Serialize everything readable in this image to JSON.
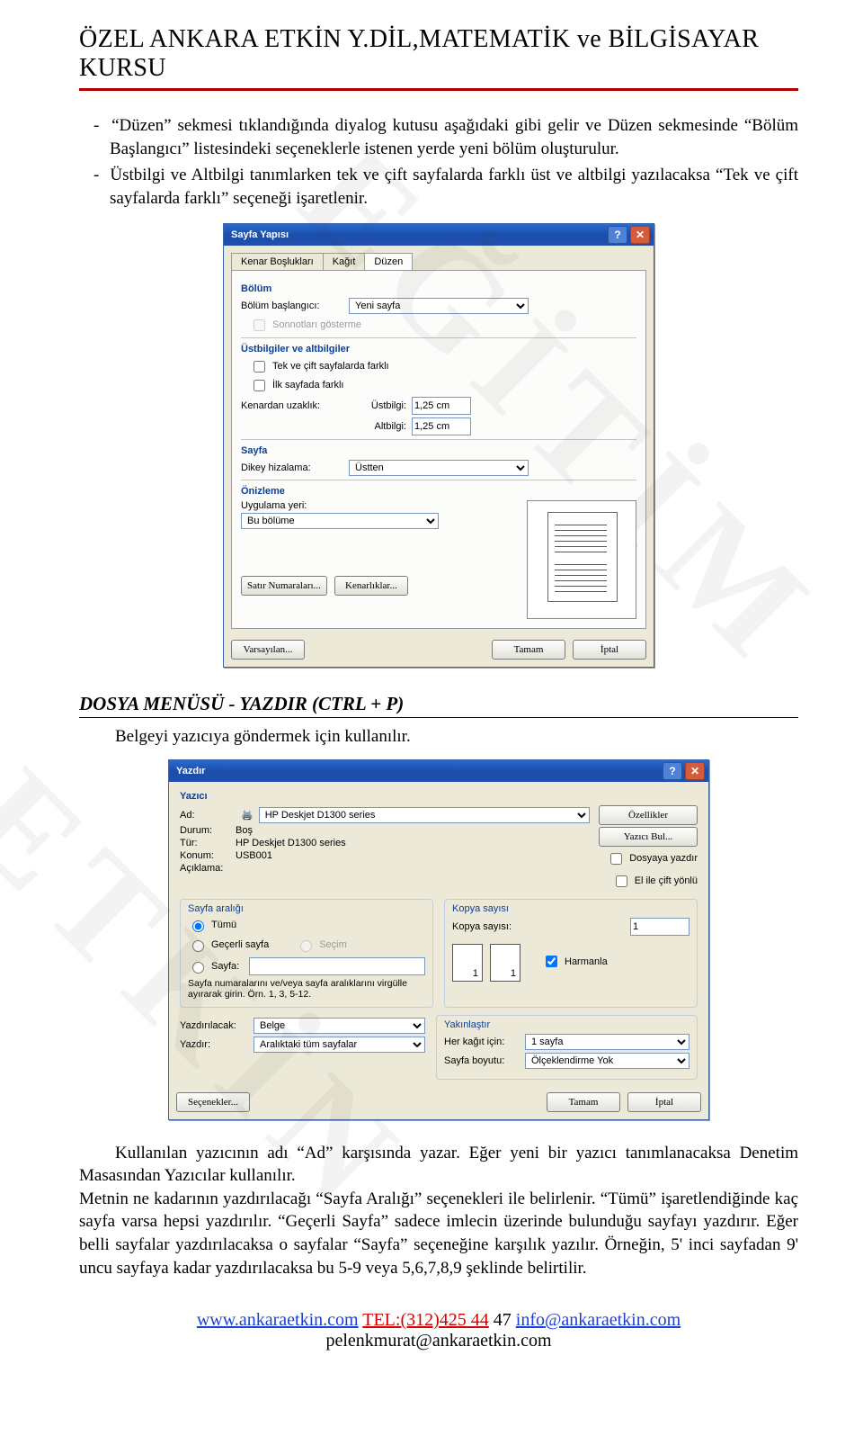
{
  "header": {
    "title": "ÖZEL ANKARA ETKİN Y.DİL,MATEMATİK ve BİLGİSAYAR KURSU"
  },
  "intro": {
    "bullet1": "“Düzen” sekmesi tıklandığında diyalog kutusu aşağıdaki gibi gelir ve Düzen sekmesinde “Bölüm Başlangıcı” listesindeki seçeneklerle istenen yerde yeni bölüm oluşturulur.",
    "bullet2": "Üstbilgi ve Altbilgi tanımlarken tek ve çift sayfalarda farklı üst ve altbilgi yazılacaksa “Tek ve çift sayfalarda farklı” seçeneği işaretlenir."
  },
  "dlg_sayfa": {
    "title": "Sayfa Yapısı",
    "tabs": {
      "t1": "Kenar Boşlukları",
      "t2": "Kağıt",
      "t3": "Düzen"
    },
    "bolum_title": "Bölüm",
    "bolum_baslangici_lbl": "Bölüm başlangıcı:",
    "bolum_baslangici_val": "Yeni sayfa",
    "sonnotlari": "Sonnotları gösterme",
    "ust_title": "Üstbilgiler ve altbilgiler",
    "tek_cift": "Tek ve çift sayfalarda farklı",
    "ilk_sayfa": "İlk sayfada farklı",
    "kenardan_lbl": "Kenardan uzaklık:",
    "ustbilgi_lbl": "Üstbilgi:",
    "altbilgi_lbl": "Altbilgi:",
    "ustbilgi_val": "1,25 cm",
    "altbilgi_val": "1,25 cm",
    "sayfa_title": "Sayfa",
    "dikey_lbl": "Dikey hizalama:",
    "dikey_val": "Üstten",
    "onizleme": "Önizleme",
    "uygulama_lbl": "Uygulama yeri:",
    "uygulama_val": "Bu bölüme",
    "btn_satir": "Satır Numaraları...",
    "btn_kenar": "Kenarlıklar...",
    "btn_varsayilan": "Varsayılan...",
    "btn_tamam": "Tamam",
    "btn_iptal": "İptal"
  },
  "section2": {
    "heading": "DOSYA MENÜSÜ -  YAZDIR (CTRL + P)",
    "desc": "Belgeyi yazıcıya göndermek için kullanılır."
  },
  "dlg_yazdir": {
    "title": "Yazdır",
    "yazici_title": "Yazıcı",
    "ad_lbl": "Ad:",
    "ad_val": "HP Deskjet D1300 series",
    "durum_lbl": "Durum:",
    "durum_val": "Boş",
    "tur_lbl": "Tür:",
    "tur_val": "HP Deskjet D1300 series",
    "konum_lbl": "Konum:",
    "konum_val": "USB001",
    "aciklama_lbl": "Açıklama:",
    "btn_ozellikler": "Özellikler",
    "btn_yazici_bul": "Yazıcı Bul...",
    "dosyaya": "Dosyaya yazdır",
    "el_cift": "El ile çift yönlü",
    "araligi_title": "Sayfa aralığı",
    "r_tumu": "Tümü",
    "r_gecerli": "Geçerli sayfa",
    "r_secim": "Seçim",
    "r_sayfa": "Sayfa:",
    "aralik_hint": "Sayfa numaralarını ve/veya sayfa aralıklarını virgülle ayırarak girin. Örn. 1, 3, 5-12.",
    "kopya_title": "Kopya sayısı",
    "kopya_lbl": "Kopya sayısı:",
    "kopya_val": "1",
    "harmanla": "Harmanla",
    "yazdirilacak_lbl": "Yazdırılacak:",
    "yazdirilacak_val": "Belge",
    "yazdir_lbl": "Yazdır:",
    "yazdir_val": "Aralıktaki tüm sayfalar",
    "yakin_title": "Yakınlaştır",
    "her_kagit_lbl": "Her kağıt için:",
    "her_kagit_val": "1 sayfa",
    "boyut_lbl": "Sayfa boyutu:",
    "boyut_val": "Ölçeklendirme Yok",
    "btn_secenekler": "Seçenekler...",
    "btn_tamam": "Tamam",
    "btn_iptal": "İptal"
  },
  "outro": {
    "p": "Kullanılan yazıcının adı “Ad” karşısında yazar. Eğer yeni bir yazıcı tanımlanacaksa Denetim Masasından Yazıcılar kullanılır.\nMetnin ne kadarının yazdırılacağı “Sayfa Aralığı” seçenekleri ile belirlenir. “Tümü” işaretlendiğinde kaç sayfa varsa hepsi yazdırılır. “Geçerli Sayfa” sadece imlecin üzerinde bulunduğu sayfayı yazdırır. Eğer belli sayfalar yazdırılacaksa o sayfalar “Sayfa” seçeneğine karşılık yazılır. Örneğin, 5' inci sayfadan 9' uncu sayfaya kadar yazdırılacaksa bu 5-9 veya 5,6,7,8,9 şeklinde belirtilir."
  },
  "footer": {
    "site": "www.ankaraetkin.com",
    "tel": "TEL:(312)425 44",
    "tel_tail": " 47 ",
    "mail1": "info@ankaraetkin.com",
    "mail2": "pelenkmurat@ankaraetkin.com"
  }
}
